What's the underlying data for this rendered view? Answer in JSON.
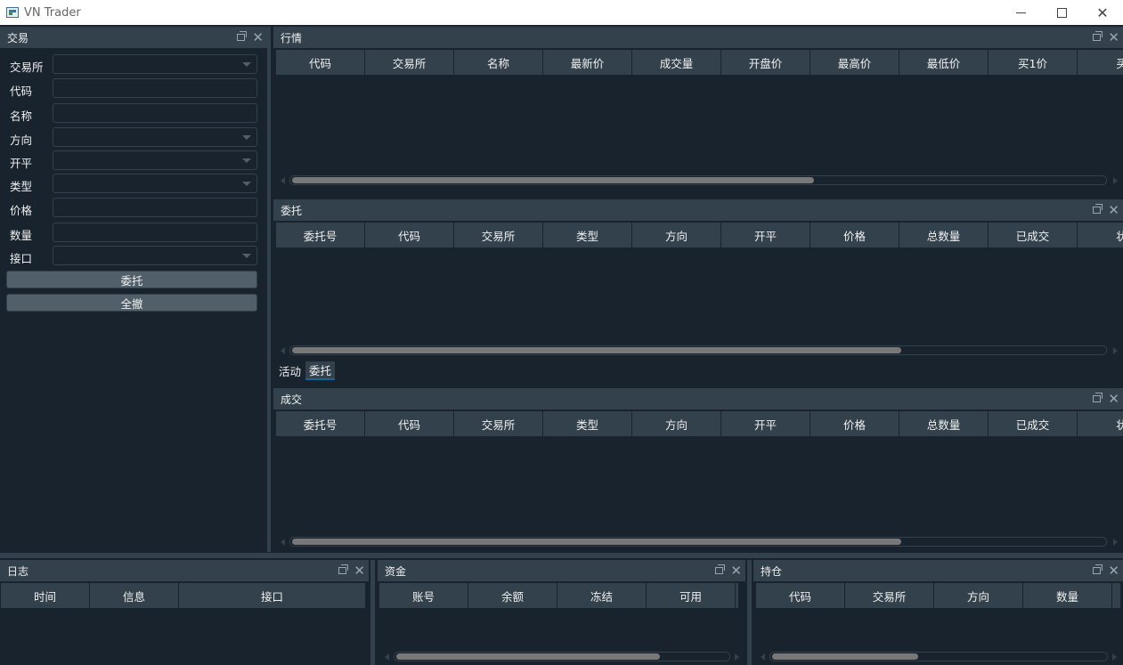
{
  "window": {
    "title": "VN Trader"
  },
  "trade": {
    "title": "交易",
    "fields": [
      {
        "label": "交易所",
        "type": "combo"
      },
      {
        "label": "代码",
        "type": "input"
      },
      {
        "label": "名称",
        "type": "input"
      },
      {
        "label": "方向",
        "type": "combo"
      },
      {
        "label": "开平",
        "type": "combo"
      },
      {
        "label": "类型",
        "type": "combo"
      },
      {
        "label": "价格",
        "type": "input"
      },
      {
        "label": "数量",
        "type": "input"
      },
      {
        "label": "接口",
        "type": "combo"
      }
    ],
    "send_label": "委托",
    "cancel_all_label": "全撤"
  },
  "market": {
    "title": "行情",
    "columns": [
      "代码",
      "交易所",
      "名称",
      "最新价",
      "成交量",
      "开盘价",
      "最高价",
      "最低价",
      "买1价",
      "买"
    ]
  },
  "orders": {
    "title": "委托",
    "columns": [
      "委托号",
      "代码",
      "交易所",
      "类型",
      "方向",
      "开平",
      "价格",
      "总数量",
      "已成交",
      "状"
    ]
  },
  "tabs": [
    {
      "label": "活动",
      "active": false
    },
    {
      "label": "委托",
      "active": true
    }
  ],
  "trades": {
    "title": "成交",
    "columns": [
      "委托号",
      "代码",
      "交易所",
      "类型",
      "方向",
      "开平",
      "价格",
      "总数量",
      "已成交",
      "状"
    ]
  },
  "log": {
    "title": "日志",
    "columns": [
      "时间",
      "信息",
      "接口"
    ]
  },
  "account": {
    "title": "资金",
    "columns": [
      "账号",
      "余额",
      "冻结",
      "可用"
    ]
  },
  "position": {
    "title": "持仓",
    "columns": [
      "代码",
      "交易所",
      "方向",
      "数量"
    ]
  },
  "icons": {
    "float": "float-icon",
    "close": "close-icon",
    "dropdown": "chevron-down-icon"
  }
}
